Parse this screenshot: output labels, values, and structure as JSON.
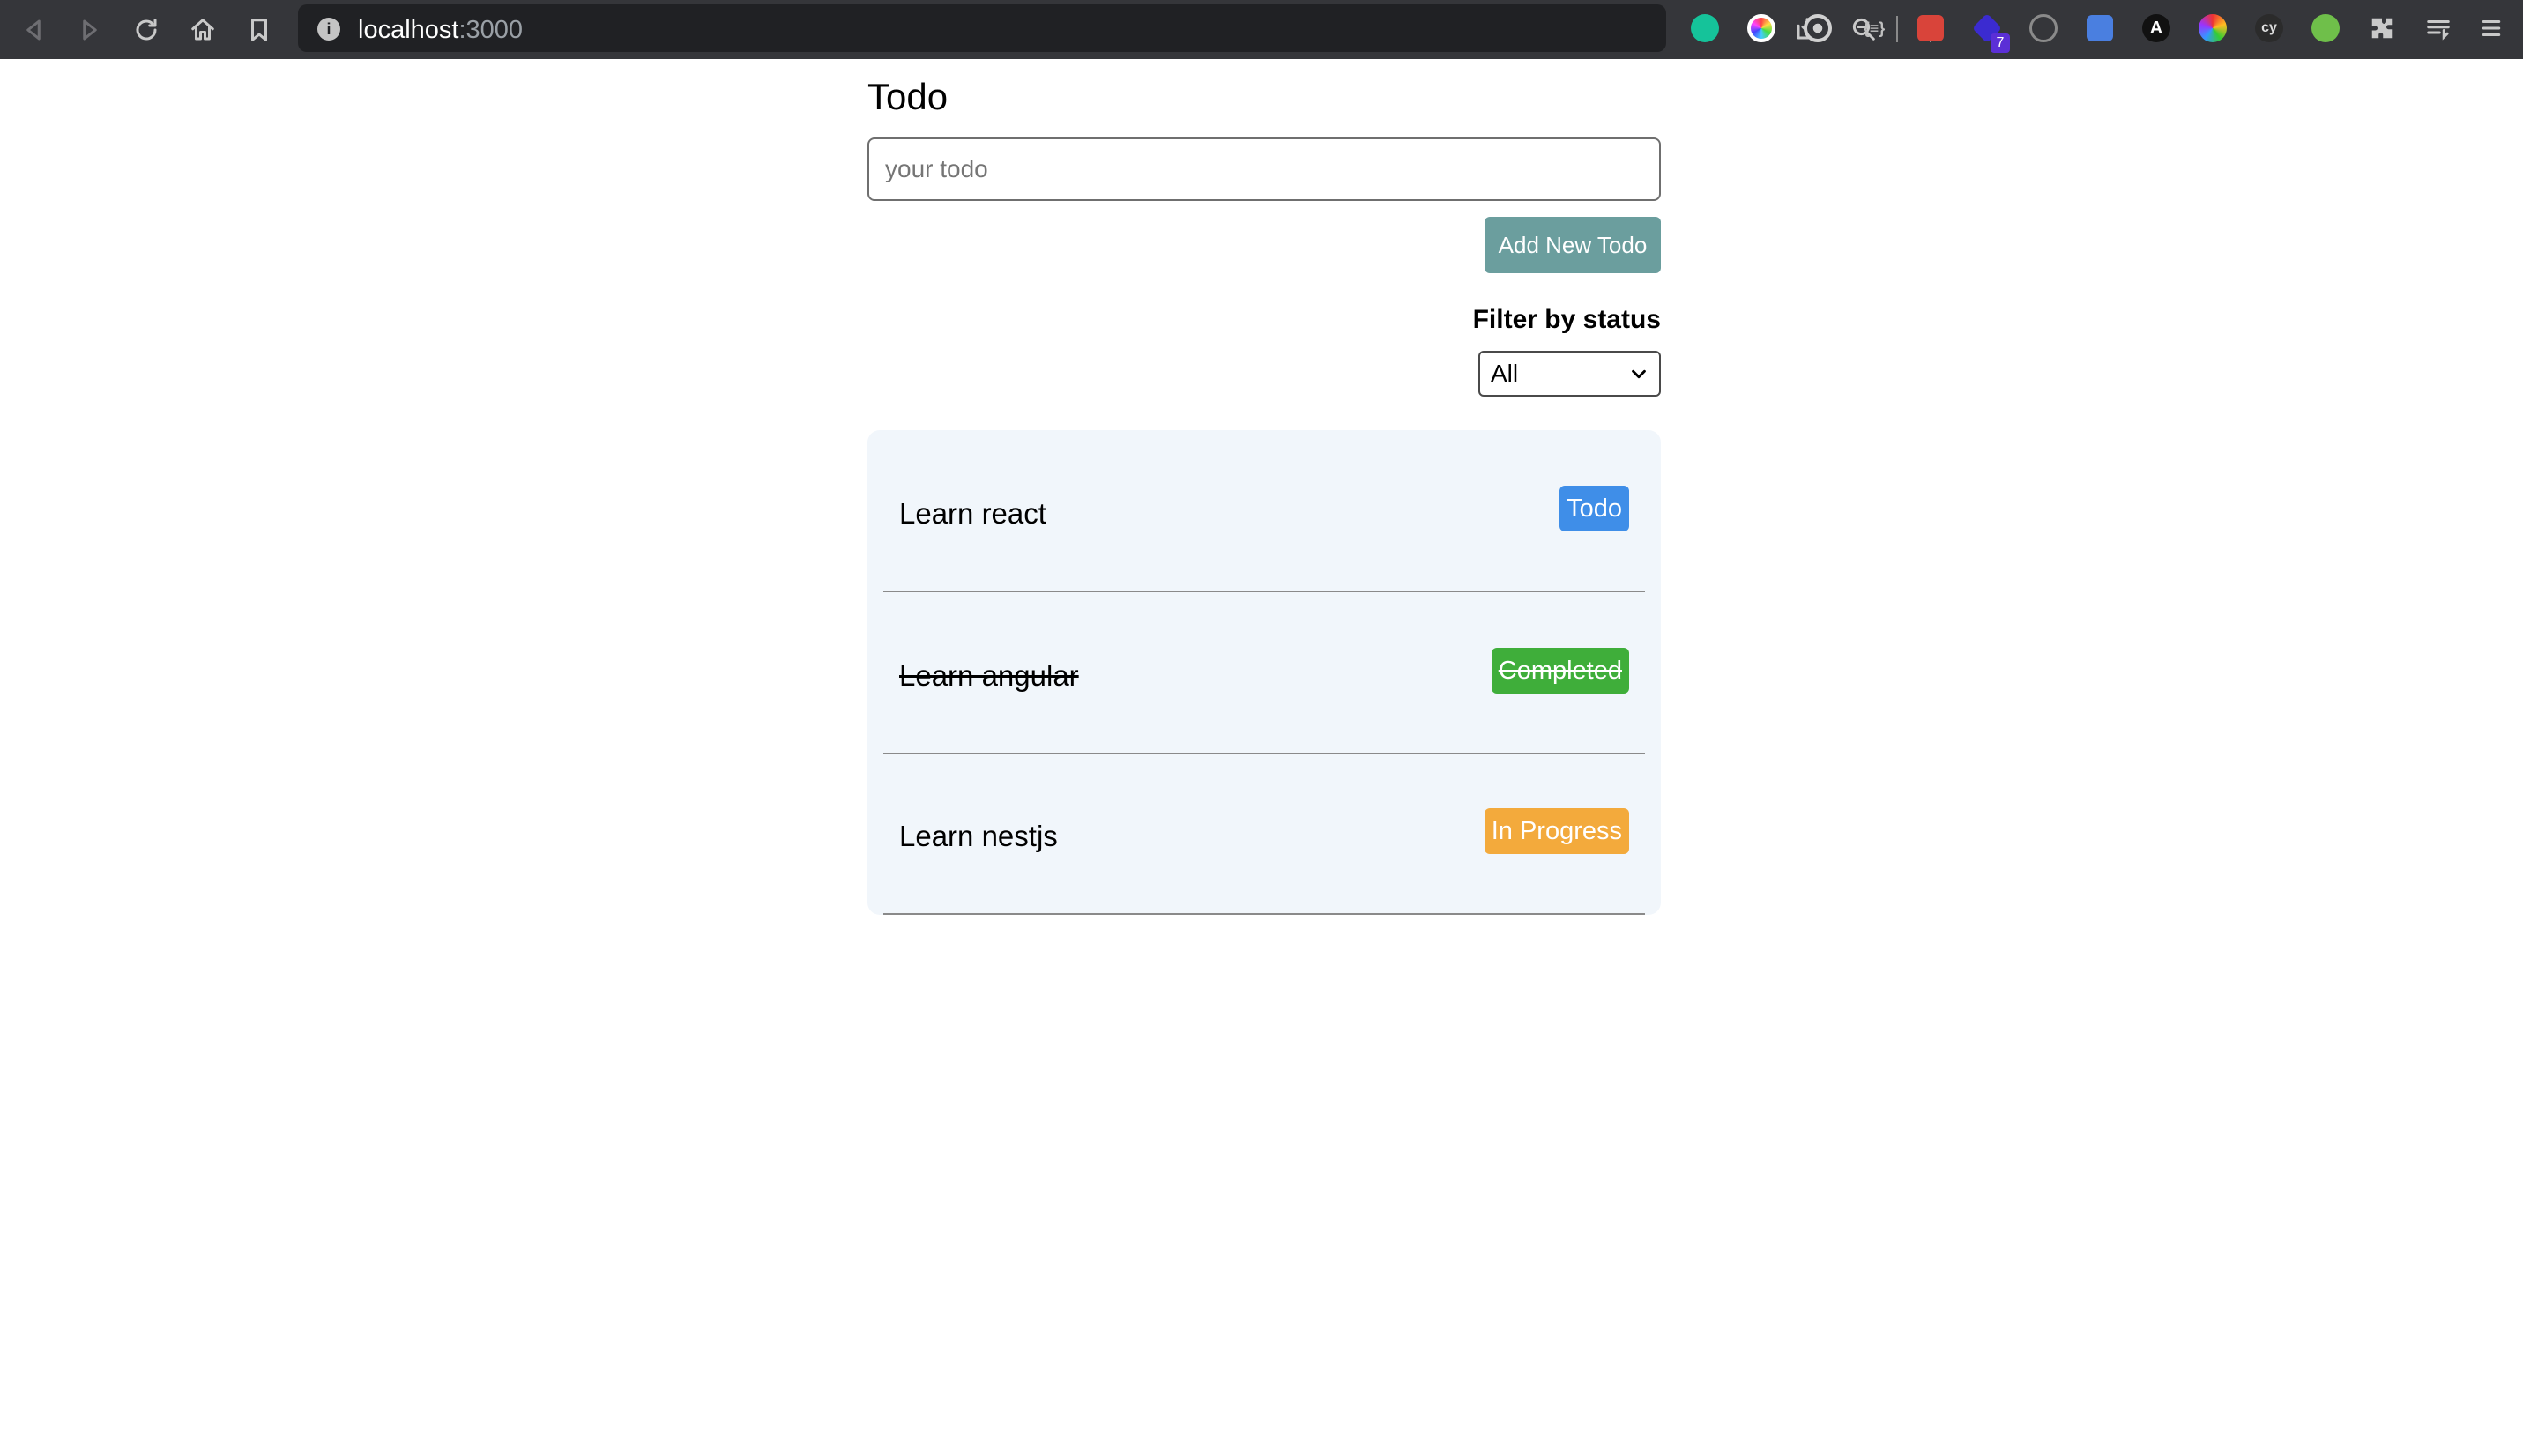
{
  "browser": {
    "url_host": "localhost",
    "url_port": ":3000",
    "extension_badge_count": "7"
  },
  "page": {
    "title": "Todo",
    "input_placeholder": "your todo",
    "input_value": "",
    "add_button_label": "Add New Todo",
    "filter_label": "Filter by status",
    "filter_selected": "All"
  },
  "todos": [
    {
      "text": "Learn react",
      "status": "Todo",
      "completed": false,
      "badge_color": "#3f8ee8"
    },
    {
      "text": "Learn angular",
      "status": "Completed",
      "completed": true,
      "badge_color": "#3fae3a"
    },
    {
      "text": "Learn nestjs",
      "status": "In Progress",
      "completed": false,
      "badge_color": "#f3aa3c"
    }
  ],
  "colors": {
    "toolbar_bg": "#35363a",
    "omnibox_bg": "#202124",
    "add_button": "#6b9e9e",
    "list_bg": "#f1f6fb"
  }
}
